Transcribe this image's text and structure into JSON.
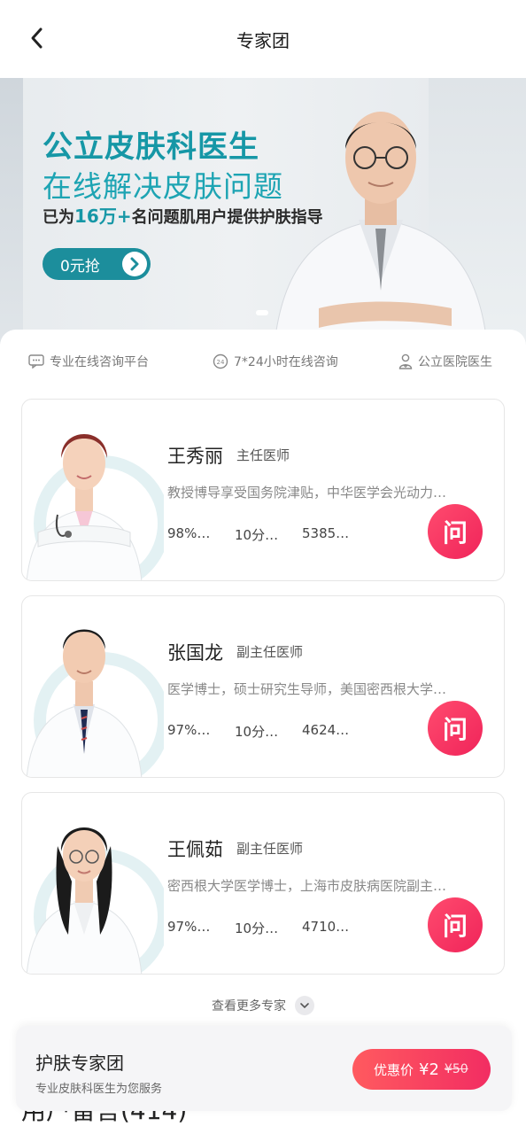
{
  "nav": {
    "title": "专家团"
  },
  "banner": {
    "headline": "公立皮肤科医生",
    "subheadline": "在线解决皮肤问题",
    "tagline_pre": "已为",
    "tagline_highlight": "16万+",
    "tagline_post": "名问题肌用户提供护肤指导",
    "cta_label": "0元抢"
  },
  "features": [
    {
      "icon": "chat-icon",
      "label": "专业在线咨询平台"
    },
    {
      "icon": "clock-24-icon",
      "label": "7*24小时在线咨询"
    },
    {
      "icon": "doctor-icon",
      "label": "公立医院医生"
    }
  ],
  "doctors": [
    {
      "name": "王秀丽",
      "title": "主任医师",
      "desc": "教授博导享受国务院津贴，中华医学会光动力…",
      "stat1": "98%…",
      "stat2": "10分…",
      "stat3": "5385…",
      "ask": "问"
    },
    {
      "name": "张国龙",
      "title": "副主任医师",
      "desc": "医学博士，硕士研究生导师，美国密西根大学…",
      "stat1": "97%…",
      "stat2": "10分…",
      "stat3": "4624…",
      "ask": "问"
    },
    {
      "name": "王佩茹",
      "title": "副主任医师",
      "desc": "密西根大学医学博士，上海市皮肤病医院副主…",
      "stat1": "97%…",
      "stat2": "10分…",
      "stat3": "4710…",
      "ask": "问"
    }
  ],
  "more_label": "查看更多专家",
  "comments_peek": "用户留言(414)",
  "bottom_bar": {
    "title": "护肤专家团",
    "subtitle": "专业皮肤科医生为您服务",
    "price_label": "优惠价",
    "price_now": "¥2",
    "price_old": "¥50"
  },
  "colors": {
    "teal": "#1697a6",
    "ask_red": "#f0245a",
    "price_red": "#f22d62"
  }
}
